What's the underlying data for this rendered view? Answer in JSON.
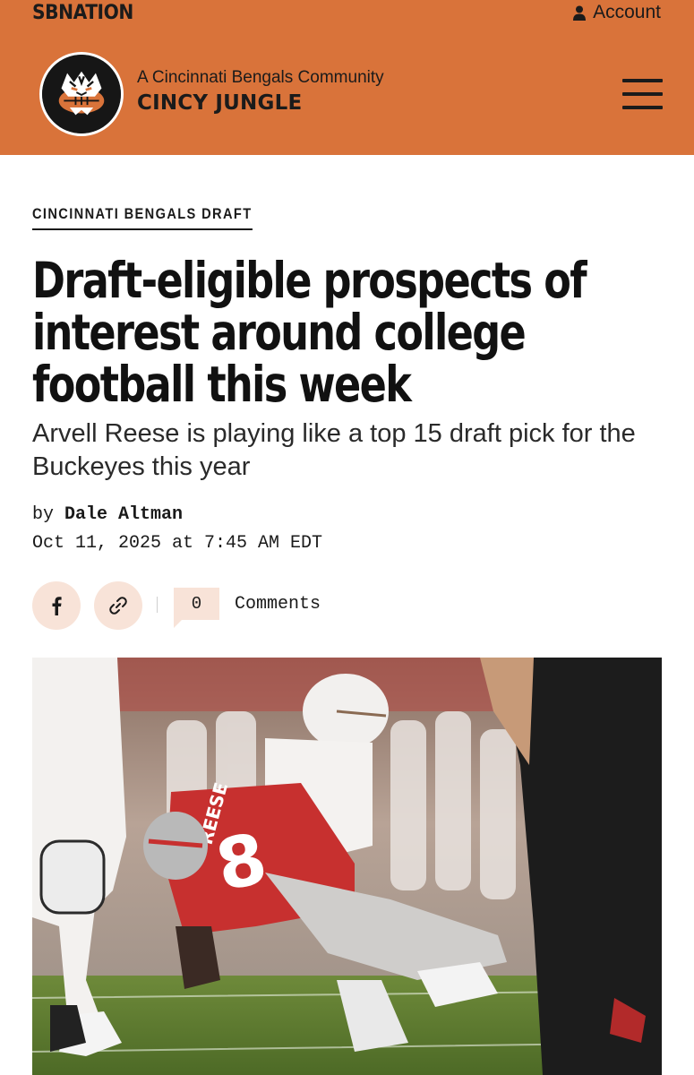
{
  "header": {
    "network": "SBNATION",
    "account_label": "Account",
    "community": "A Cincinnati Bengals Community",
    "site_name": "CINCY JUNGLE",
    "background": "#d9733a"
  },
  "article": {
    "category": "CINCINNATI BENGALS DRAFT",
    "headline": "Draft-eligible prospects of interest around college football this week",
    "subheadline": "Arvell Reese is playing like a top 15 draft pick for the Buckeyes this year",
    "by_label": "by",
    "author": "Dale Altman",
    "date": "Oct 11, 2025 at 7:45 AM EDT",
    "share": {
      "facebook_icon": "facebook-icon",
      "link_icon": "link-icon"
    },
    "comments": {
      "count": "0",
      "label": "Comments"
    },
    "image": {
      "jersey_name": "REESE",
      "jersey_number": "8"
    }
  },
  "colors": {
    "accent": "#d9733a",
    "share_bg": "#f8e3d8",
    "buckeye_red": "#c7302f"
  }
}
